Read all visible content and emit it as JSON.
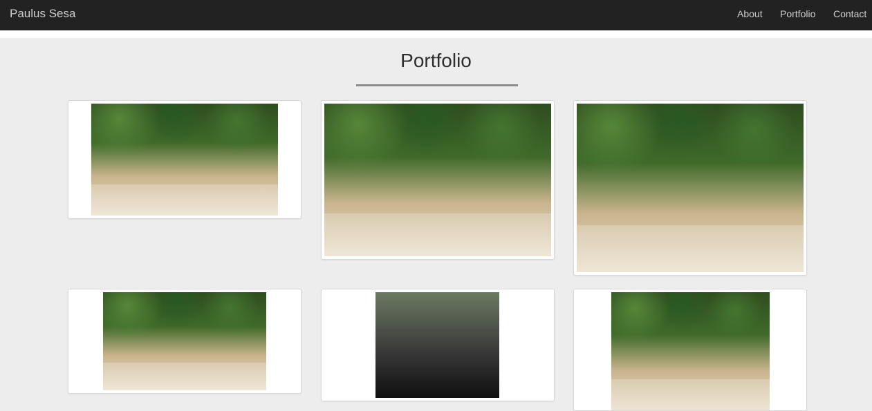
{
  "navbar": {
    "brand": "Paulus Sesa",
    "links": [
      "About",
      "Portfolio",
      "Contact"
    ]
  },
  "main": {
    "title": "Portfolio"
  },
  "gallery": {
    "items": [
      {
        "name": "portfolio-item-1",
        "alt": "group photo on beach"
      },
      {
        "name": "portfolio-item-2",
        "alt": "group photo on beach"
      },
      {
        "name": "portfolio-item-3",
        "alt": "group photo on beach"
      },
      {
        "name": "portfolio-item-4",
        "alt": "group photo on beach"
      },
      {
        "name": "portfolio-item-5",
        "alt": "two people selfie"
      },
      {
        "name": "portfolio-item-6",
        "alt": "group photo on beach"
      }
    ]
  },
  "colors": {
    "navbar_bg": "#222222",
    "nav_text": "#cfcfcf",
    "page_bg": "#ededed",
    "title_text": "#2e2e2e",
    "rule": "#8c8c8c"
  }
}
